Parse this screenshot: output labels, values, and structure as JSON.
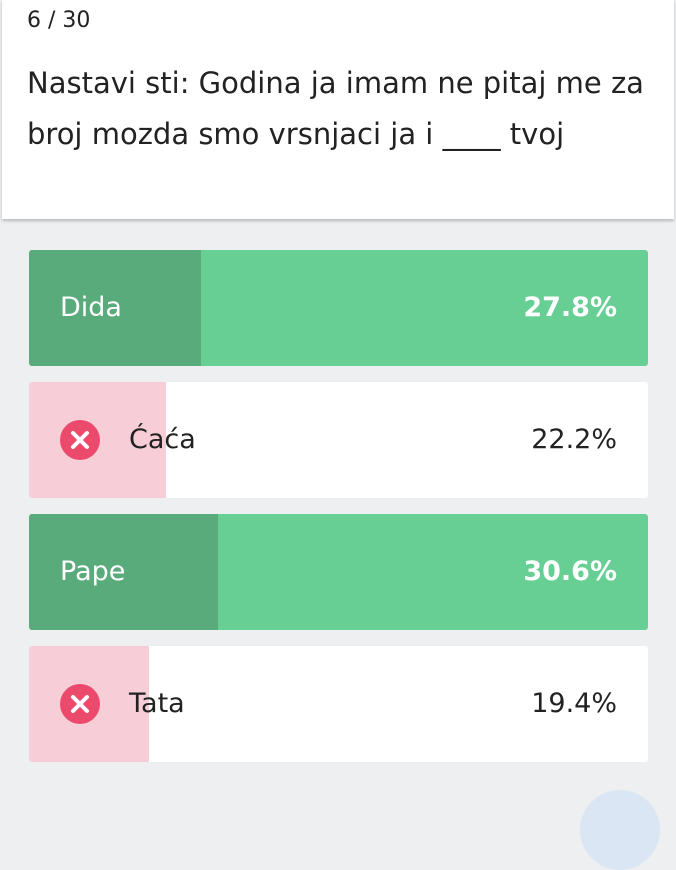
{
  "header": {
    "progress": "6 / 30",
    "question": "Nastavi sti: Godina ja imam ne pitaj me za broj mozda smo vrsnjaci ja i ____ tvoj"
  },
  "answers": [
    {
      "label": "Dida",
      "percent": "27.8%",
      "fraction": 0.278,
      "status": "correct"
    },
    {
      "label": "Ćaća",
      "percent": "22.2%",
      "fraction": 0.222,
      "status": "wrong",
      "icon": "x-circle-icon"
    },
    {
      "label": "Pape",
      "percent": "30.6%",
      "fraction": 0.306,
      "status": "correct"
    },
    {
      "label": "Tata",
      "percent": "19.4%",
      "fraction": 0.194,
      "status": "wrong",
      "icon": "x-circle-icon"
    }
  ],
  "colors": {
    "correct_bg": "#68cf94",
    "correct_fill": "#5aab7c",
    "wrong_fill": "#f7cdd8",
    "wrong_icon": "#ec4a6c"
  }
}
